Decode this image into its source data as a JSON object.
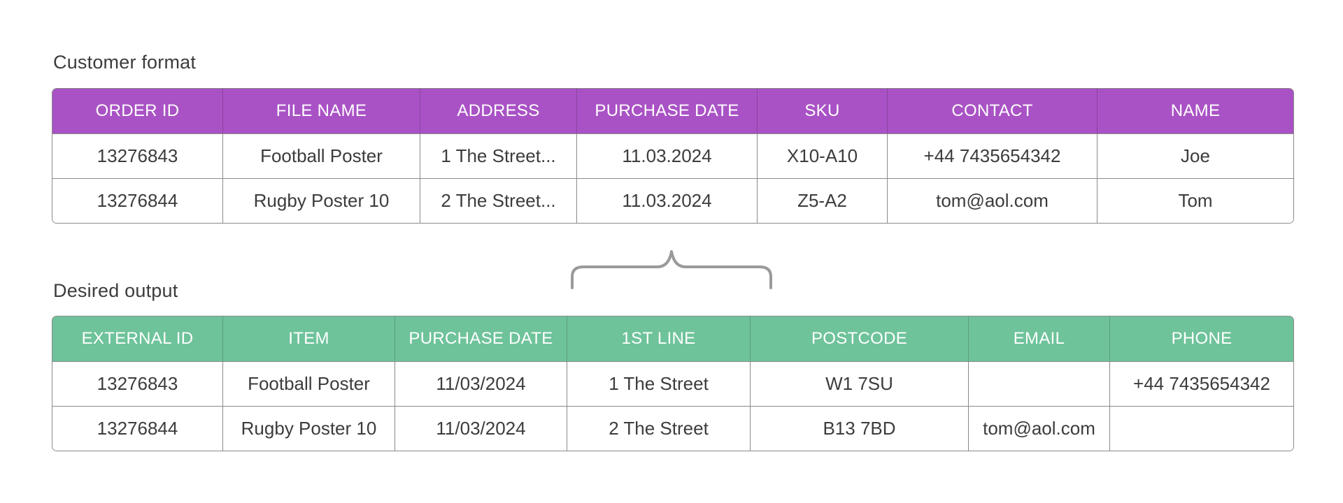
{
  "customer_format": {
    "title": "Customer format",
    "header_color": "#a952c5",
    "columns": [
      "ORDER ID",
      "FILE NAME",
      "ADDRESS",
      "PURCHASE DATE",
      "SKU",
      "CONTACT",
      "NAME"
    ],
    "rows": [
      [
        "13276843",
        "Football Poster",
        "1 The Street...",
        "11.03.2024",
        "X10-A10",
        "+44 7435654342",
        "Joe"
      ],
      [
        "13276844",
        "Rugby Poster 10",
        "2 The Street...",
        "11.03.2024",
        "Z5-A2",
        "tom@aol.com",
        "Tom"
      ]
    ]
  },
  "desired_output": {
    "title": "Desired output",
    "header_color": "#6ec39a",
    "columns": [
      "EXTERNAL ID",
      "ITEM",
      "PURCHASE DATE",
      "1ST LINE",
      "POSTCODE",
      "EMAIL",
      "PHONE"
    ],
    "rows": [
      [
        "13276843",
        "Football Poster",
        "11/03/2024",
        "1 The Street",
        "W1 7SU",
        "",
        "+44 7435654342"
      ],
      [
        "13276844",
        "Rugby Poster 10",
        "11/03/2024",
        "2 The Street",
        "B13 7BD",
        "tom@aol.com",
        ""
      ]
    ]
  },
  "brace_icon": "curly-brace-icon",
  "brace_color": "#9a9a9a"
}
